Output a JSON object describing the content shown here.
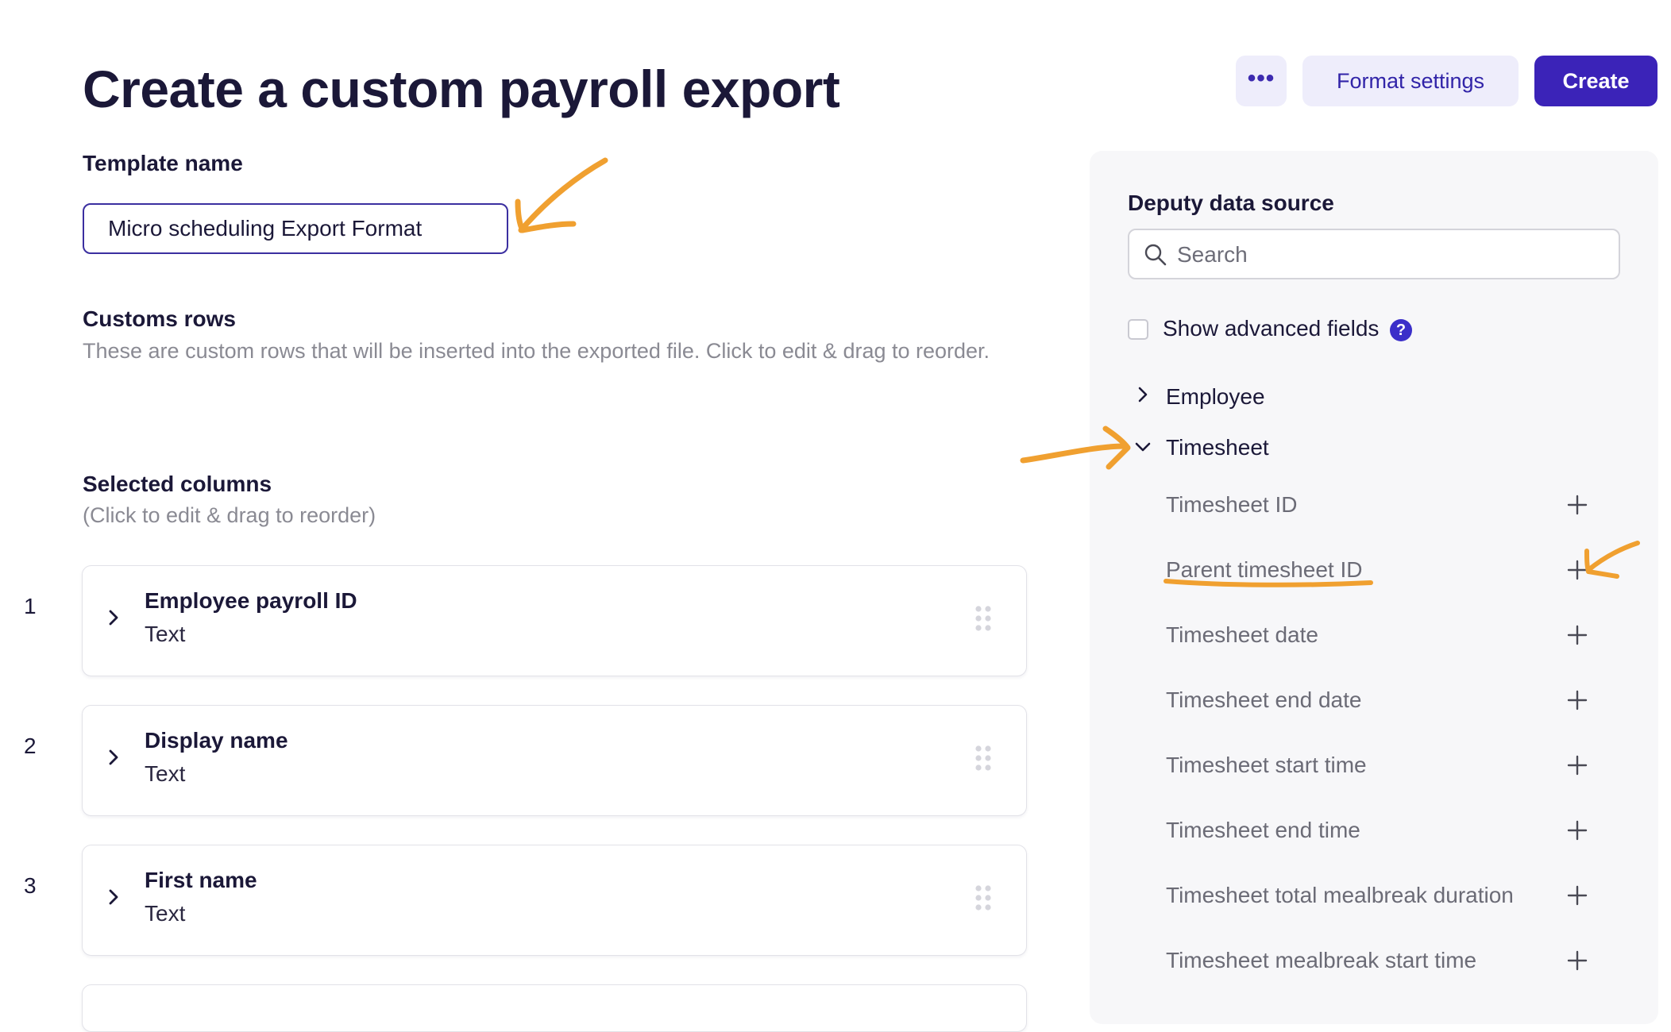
{
  "header": {
    "title": "Create a custom payroll export",
    "more_label": "•••",
    "format_settings_label": "Format settings",
    "create_label": "Create"
  },
  "template": {
    "label": "Template name",
    "value": "Micro scheduling Export Format"
  },
  "custom_rows": {
    "title": "Customs rows",
    "description": "These are custom rows that will be inserted into the exported file. Click to edit & drag to reorder."
  },
  "selected_columns": {
    "title": "Selected columns",
    "hint": "(Click to edit & drag to reorder)",
    "items": [
      {
        "index": "1",
        "name": "Employee payroll ID",
        "type": "Text"
      },
      {
        "index": "2",
        "name": "Display name",
        "type": "Text"
      },
      {
        "index": "3",
        "name": "First name",
        "type": "Text"
      }
    ]
  },
  "data_source": {
    "title": "Deputy data source",
    "search_placeholder": "Search",
    "advanced_label": "Show advanced fields",
    "help_icon_text": "?",
    "groups": [
      {
        "label": "Employee",
        "expanded": false
      },
      {
        "label": "Timesheet",
        "expanded": true
      }
    ],
    "timesheet_fields": [
      "Timesheet ID",
      "Parent timesheet ID",
      "Timesheet date",
      "Timesheet end date",
      "Timesheet start time",
      "Timesheet end time",
      "Timesheet total mealbreak duration",
      "Timesheet mealbreak start time"
    ]
  },
  "colors": {
    "primary": "#3b23b8",
    "secondary_bg": "#eeedfb",
    "annotation": "#f0a030",
    "help_icon": "#3b2fc9"
  }
}
